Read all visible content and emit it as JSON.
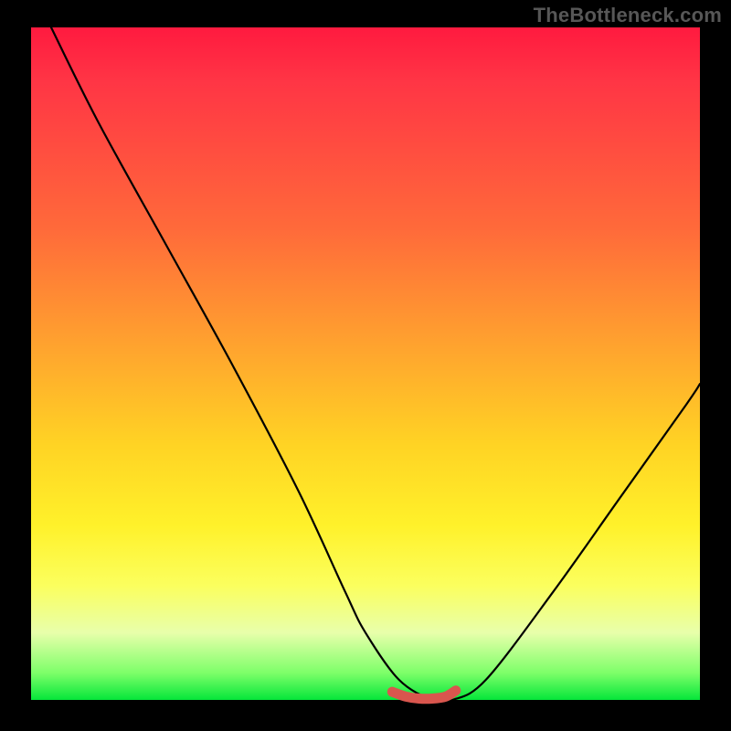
{
  "watermark": "TheBottleneck.com",
  "chart_data": {
    "type": "line",
    "title": "",
    "xlabel": "",
    "ylabel": "",
    "xlim": [
      0,
      100
    ],
    "ylim": [
      0,
      100
    ],
    "series": [
      {
        "name": "bottleneck-curve",
        "x": [
          3,
          10,
          20,
          30,
          40,
          47,
          50,
          55,
          60,
          63,
          68,
          78,
          88,
          98,
          100
        ],
        "values": [
          100,
          86,
          68,
          50,
          31,
          16,
          10,
          3,
          0,
          0,
          3,
          16,
          30,
          44,
          47
        ]
      },
      {
        "name": "optimal-band",
        "x": [
          54,
          56,
          58,
          60,
          62,
          63.5
        ],
        "values": [
          1.2,
          0.5,
          0.2,
          0.2,
          0.5,
          1.4
        ]
      }
    ],
    "gradient_stops": [
      {
        "pos": 0,
        "color": "#ff1a3f"
      },
      {
        "pos": 30,
        "color": "#ff6a3a"
      },
      {
        "pos": 62,
        "color": "#ffd324"
      },
      {
        "pos": 90,
        "color": "#e8ffab"
      },
      {
        "pos": 100,
        "color": "#05e63a"
      }
    ]
  }
}
